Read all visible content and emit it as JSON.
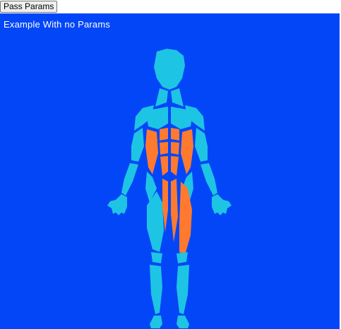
{
  "toolbar": {
    "pass_params_label": "Pass Params"
  },
  "main": {
    "title": "Example With no Params"
  },
  "colors": {
    "background": "#0346f8",
    "muscle_default": "#1ec4e4",
    "muscle_highlight": "#ff7a2f",
    "text": "#ffffff"
  },
  "body_map": {
    "view": "front",
    "highlighted_muscles": [
      "abdominals",
      "obliques",
      "quadriceps-right",
      "adductors"
    ]
  }
}
